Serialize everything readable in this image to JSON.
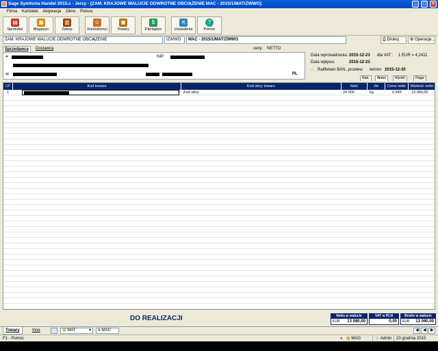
{
  "window": {
    "title": "Sage Symfonia Handel 2015.c - Jerzy - [ZAM. KRAJOWE WALUCIE ODWROTNE OBCIĄŻENIE MAC - 2015/1/MAT/ZWWO]",
    "controls": {
      "minimize": "_",
      "maximize": "□",
      "close": "×"
    }
  },
  "menu": [
    "Firma",
    "Kartoteki",
    "Aktywacja",
    "Okno",
    "Pomoc"
  ],
  "toolbar": {
    "buttons": [
      {
        "label": "Sprzedaż",
        "icon": "invoice-icon",
        "color": "#c0392b"
      },
      {
        "label": "Magazyn",
        "icon": "warehouse-icon",
        "color": "#d68910"
      },
      {
        "label": "Zakup",
        "icon": "purchase-icon",
        "color": "#a04000"
      },
      {
        "label": "Kontrahenci",
        "icon": "contacts-icon",
        "color": "#ca6f1e"
      },
      {
        "label": "Towary",
        "icon": "goods-icon",
        "color": "#b9770e"
      },
      {
        "label": "Pieniądze",
        "icon": "money-icon",
        "color": "#229954"
      },
      {
        "label": "Ustawienia",
        "icon": "settings-icon",
        "color": "#2e86c1"
      },
      {
        "label": "Pomoc",
        "icon": "help-icon",
        "color": "#17a589"
      }
    ]
  },
  "docbar": {
    "doc_type": "ZAM. KRAJOWE WALUCIE ODWROTNE OBCIĄŻENIE",
    "code": "IZWWO",
    "number": "MAC - 2015/1/MAT/ZWWO",
    "print_label": "Drukuj",
    "operations_label": "Operacje..."
  },
  "party": {
    "tabs": [
      "Sprzedawca",
      "Dostawca"
    ],
    "prices_label": "ceny:",
    "prices_value": "NETTO",
    "nip_label": "NIP:",
    "country": "PL"
  },
  "info": {
    "date_received_label": "Data wprowadzenia:",
    "date_received": "2015-12-23",
    "vat_label": "dla VAT :",
    "rate_text": "1 EUR = 4,2411",
    "date_inflow_label": "Data wpływu:",
    "date_inflow": "2015-12-23",
    "bank": "Raiffeisen BAN...",
    "payment": "przelew",
    "due_label": "termin:",
    "due_date": "2015-12-30",
    "tabs": [
      "Rab.",
      "Ilości",
      "Wyniki",
      "Flaga"
    ]
  },
  "grid": {
    "columns": [
      "LP",
      "Kod towaru",
      "Kod obcy towaru",
      "Ilość",
      "Jm",
      "Cena netto",
      "Wartość netto"
    ],
    "rows": [
      {
        "lp": "1",
        "code": "",
        "foreign_code": "Kod obcy",
        "qty": "24 000",
        "unit": "kg",
        "price": "0,545",
        "value": "13 080,00"
      }
    ]
  },
  "status_text": "DO REALIZACJI",
  "totals": [
    {
      "label": "Netto w walucie",
      "currency": "EUR",
      "value": "13 080,00"
    },
    {
      "label": "VAT w PLN",
      "currency": "",
      "value": "0,00"
    },
    {
      "label": "Brutto w walucie",
      "currency": "EUR",
      "value": "13 080,00"
    }
  ],
  "bottom": {
    "tabs": [
      "Towary",
      "Inne"
    ],
    "warehouse": "MAT",
    "company": "MAC"
  },
  "statusbar": {
    "hint": "F1 - Pomoc",
    "module": "MAG",
    "user": "Admin",
    "date": "23 grudnia 2015"
  }
}
